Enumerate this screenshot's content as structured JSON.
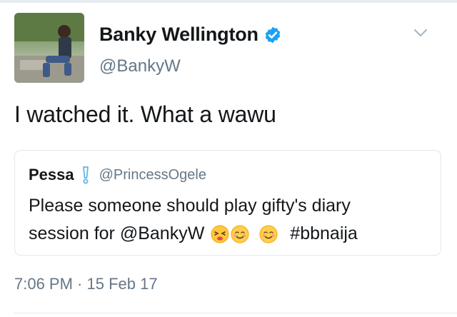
{
  "tweet": {
    "author": {
      "display_name": "Banky Wellington",
      "handle": "@BankyW",
      "verified": true,
      "avatar_icon": "profile-photo"
    },
    "text": "I watched it. What a wawu",
    "menu_icon": "chevron-down-icon",
    "timestamp": "7:06 PM · 15 Feb 17",
    "quoted": {
      "display_name": "Pessa",
      "name_emoji": "exclamation-emoji",
      "handle": "@PrincessOgele",
      "text_line1": "Please someone should play gifty's diary",
      "text_line2_start": "session for @BankyW",
      "emojis": [
        "tired-face-emoji",
        "smiling-face-emoji",
        "smiling-face-emoji"
      ],
      "hashtag": "#bbnaija"
    }
  },
  "colors": {
    "primary_text": "#14171a",
    "secondary_text": "#657786",
    "verified_blue": "#1da1f2",
    "border": "#e1e8ed"
  }
}
